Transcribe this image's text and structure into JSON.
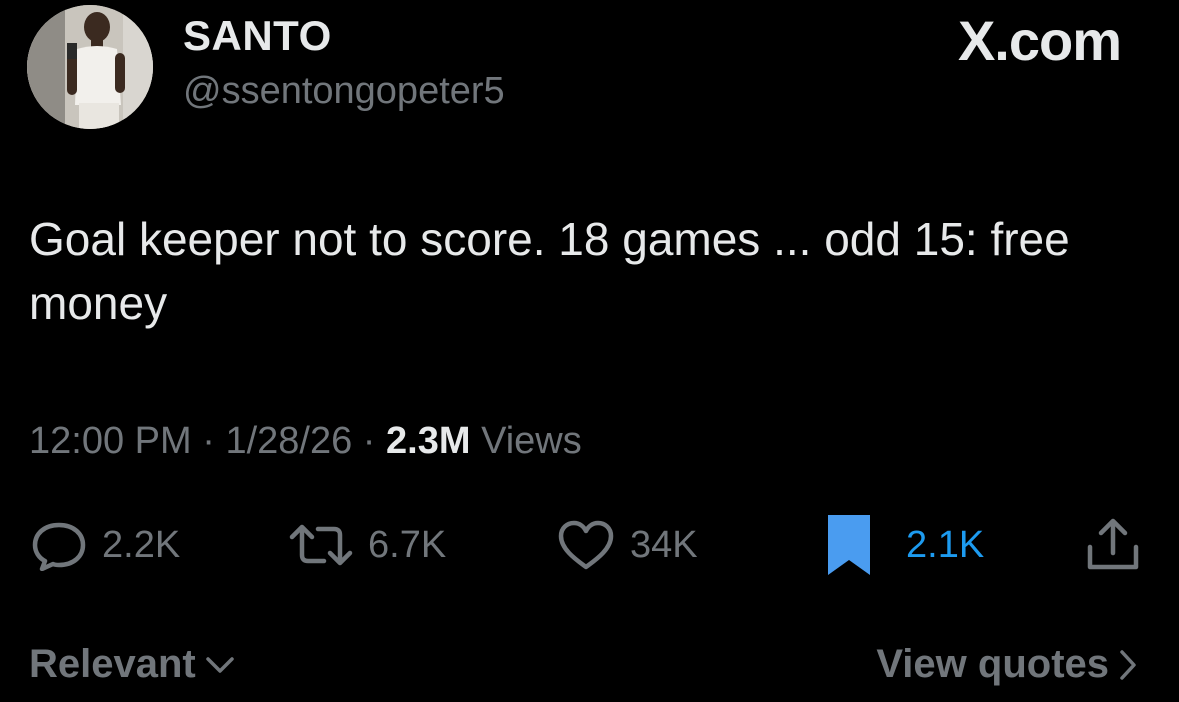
{
  "author": {
    "display_name": "SANTO",
    "handle": "@ssentongopeter5",
    "avatar_icon": "profile-photo"
  },
  "brand": {
    "label": "X.com"
  },
  "tweet": {
    "text": "Goal keeper not to score. 18 games ... odd 15: free money",
    "time": "12:00 PM",
    "date": "1/28/26",
    "separator": "·",
    "views_count": "2.3M",
    "views_label": "Views"
  },
  "actions": {
    "reply": {
      "icon": "reply-icon",
      "count": "2.2K"
    },
    "repost": {
      "icon": "repost-icon",
      "count": "6.7K"
    },
    "like": {
      "icon": "heart-icon",
      "count": "34K"
    },
    "bookmark": {
      "icon": "bookmark-icon",
      "count": "2.1K",
      "active": true
    },
    "share": {
      "icon": "share-icon"
    }
  },
  "footer": {
    "sort_label": "Relevant",
    "quotes_label": "View quotes"
  },
  "colors": {
    "background": "#000000",
    "primary_text": "#e7e9ea",
    "secondary_text": "#71767b",
    "accent": "#1d9bf0"
  }
}
